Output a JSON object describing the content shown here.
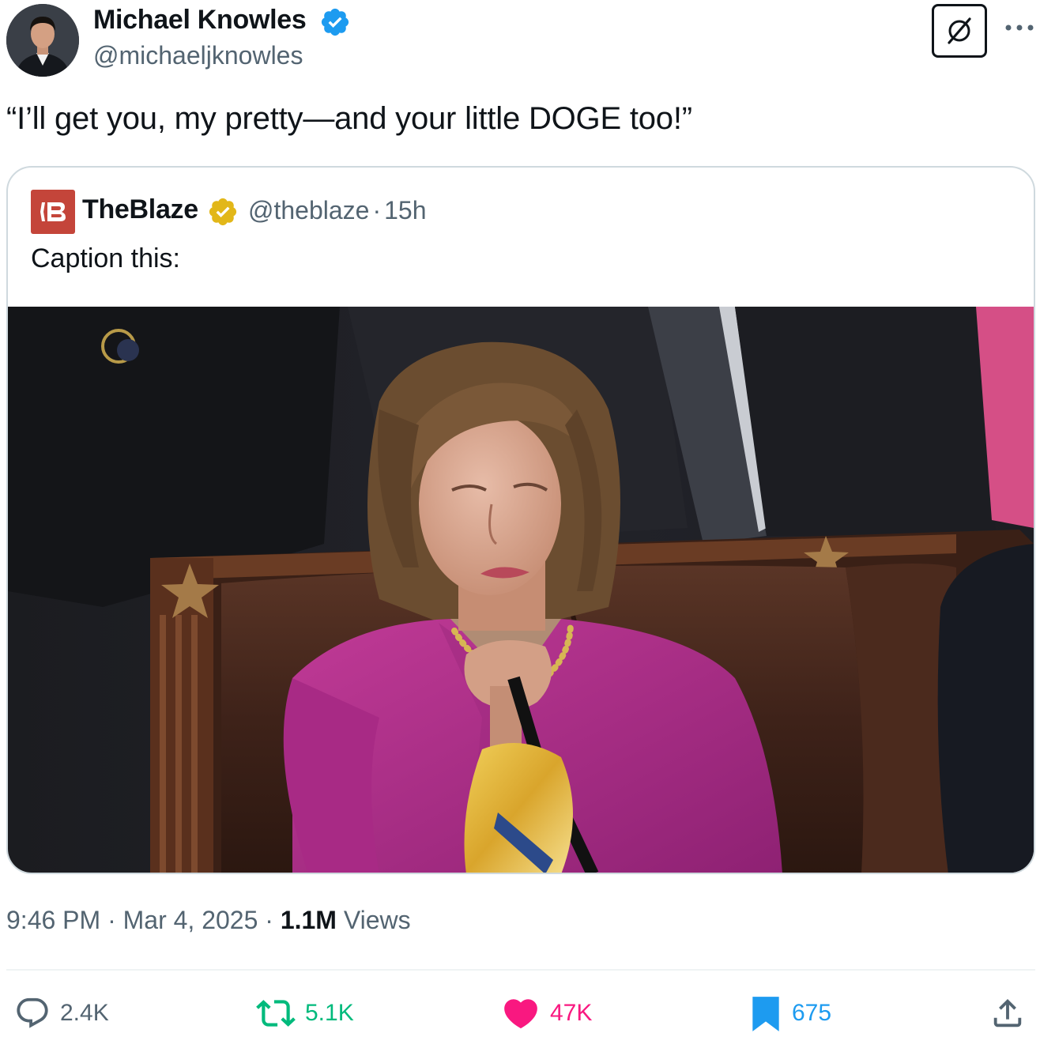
{
  "author": {
    "name": "Michael Knowles",
    "handle": "@michaeljknowles",
    "avatar_icon": "profile-photo",
    "verified_color": "#1d9bf0"
  },
  "tweet": {
    "text": "“I’ll get you, my pretty—and your little DOGE too!”"
  },
  "quoted": {
    "name": "TheBlaze",
    "handle": "@theblaze",
    "separator": "·",
    "age": "15h",
    "text": "Caption this:",
    "logo_icon": "theblaze-logo",
    "logo_color": "#c4453a",
    "verified_color": "#e2b719",
    "photo": "woman-in-magenta-jacket-seated-in-leather-chair"
  },
  "meta": {
    "time": "9:46 PM",
    "separator": "·",
    "date": "Mar 4, 2025",
    "views_count": "1.1M",
    "views_label": "Views"
  },
  "actions": {
    "replies": "2.4K",
    "reposts": "5.1K",
    "likes": "47K",
    "bookmarks": "675"
  },
  "colors": {
    "text": "#0f1419",
    "secondary": "#536471",
    "repost": "#00ba7c",
    "like": "#f91880",
    "bookmark": "#1d9bf0"
  }
}
